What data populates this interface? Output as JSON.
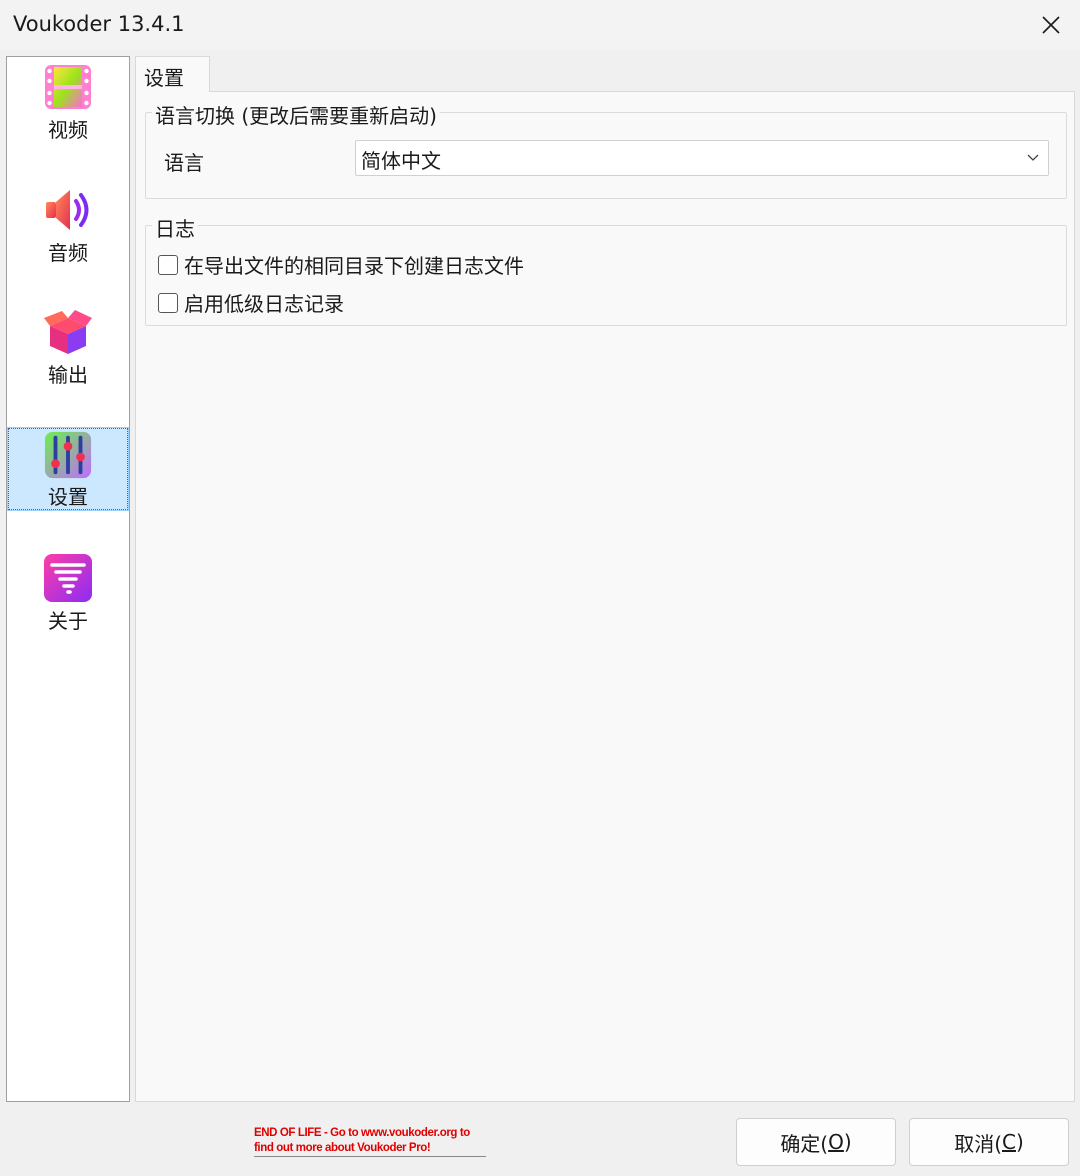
{
  "window": {
    "title": "Voukoder 13.4.1"
  },
  "sidebar": {
    "items": [
      {
        "label": "视频",
        "icon": "video-film-icon"
      },
      {
        "label": "音频",
        "icon": "speaker-icon"
      },
      {
        "label": "输出",
        "icon": "box-output-icon"
      },
      {
        "label": "设置",
        "icon": "sliders-icon",
        "selected": true
      },
      {
        "label": "关于",
        "icon": "tornado-about-icon"
      }
    ]
  },
  "tab": {
    "label": "设置"
  },
  "language_group": {
    "title": "语言切换 (更改后需要重新启动)",
    "label": "语言",
    "selected": "简体中文"
  },
  "log_group": {
    "title": "日志",
    "options": [
      {
        "label": "在导出文件的相同目录下创建日志文件",
        "checked": false
      },
      {
        "label": "启用低级日志记录",
        "checked": false
      }
    ]
  },
  "footer": {
    "eol_line1": "END OF LIFE - Go to www.voukoder.org to",
    "eol_line2": "find out more about Voukoder Pro!",
    "ok_label": "确定(",
    "ok_key": "O",
    "ok_end": ")",
    "cancel_label": "取消(",
    "cancel_key": "C",
    "cancel_end": ")"
  },
  "colors": {
    "selected_bg": "#cce8ff",
    "eol_text": "#e00000"
  }
}
